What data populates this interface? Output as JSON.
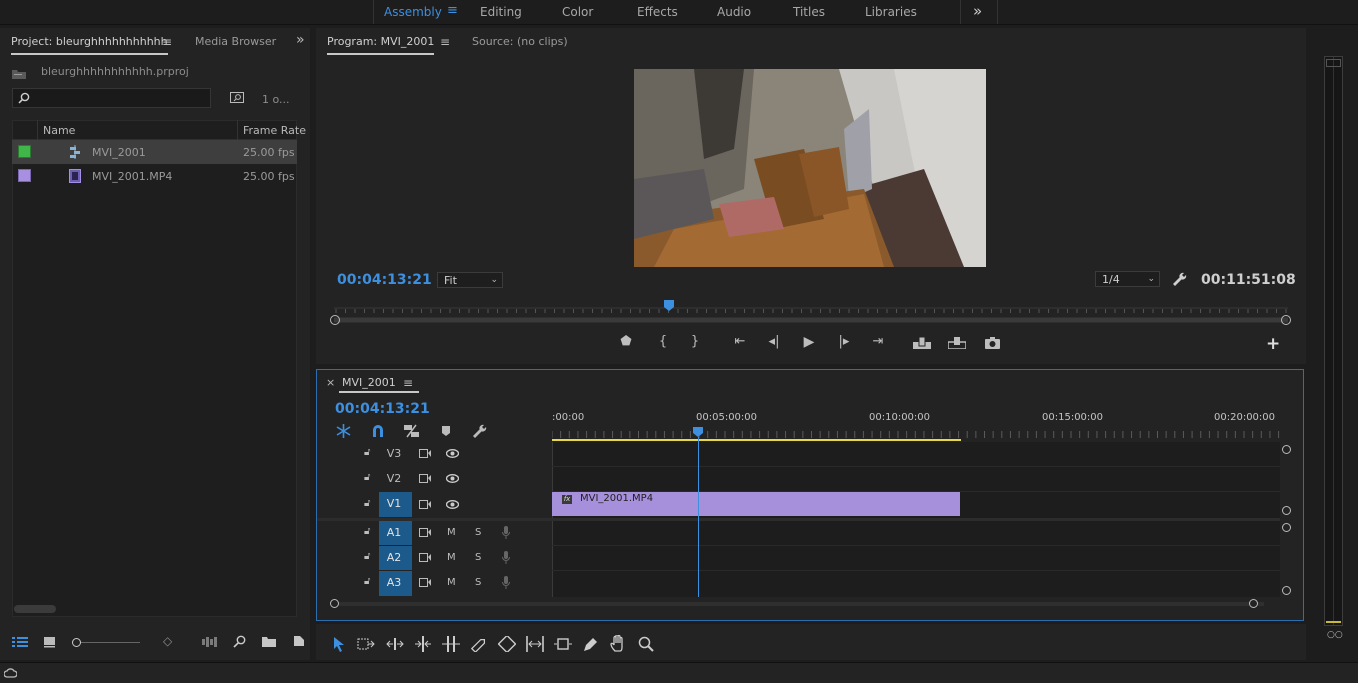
{
  "workspaces": [
    "Assembly",
    "Editing",
    "Color",
    "Effects",
    "Audio",
    "Titles",
    "Libraries"
  ],
  "workspaces_more": "»",
  "project": {
    "tab_project": "Project: bleurghhhhhhhhhhh",
    "tab_media": "Media Browser",
    "more": "»",
    "file": "bleurghhhhhhhhhhh.prproj",
    "items_count": "1 o...",
    "col_name": "Name",
    "col_fps": "Frame Rate",
    "rows": [
      {
        "name": "MVI_2001",
        "fps": "25.00 fps",
        "color": "#3fb54a",
        "icon": "sequence-icon"
      },
      {
        "name": "MVI_2001.MP4",
        "fps": "25.00 fps",
        "color": "#a88fe0",
        "icon": "film-icon"
      }
    ]
  },
  "monitor": {
    "tab_program": "Program: MVI_2001",
    "tab_source": "Source: (no clips)",
    "timecode": "00:04:13:21",
    "fit": "Fit",
    "resolution": "1/4",
    "duration": "00:11:51:08"
  },
  "timeline": {
    "close": "×",
    "seq_name": "MVI_2001",
    "timecode": "00:04:13:21",
    "ruler": [
      ":00:00",
      "00:05:00:00",
      "00:10:00:00",
      "00:15:00:00",
      "00:20:00:00"
    ],
    "video_tracks": [
      "V3",
      "V2",
      "V1"
    ],
    "audio_tracks": [
      "A1",
      "A2",
      "A3"
    ],
    "mute": "M",
    "solo": "S",
    "clip_name": "MVI_2001.MP4",
    "fx": "fx"
  },
  "colors": {
    "accent": "#3d8fe0",
    "clip": "#a68fdb",
    "track_on": "#1c5a8c",
    "work_area": "#e6d84a"
  }
}
